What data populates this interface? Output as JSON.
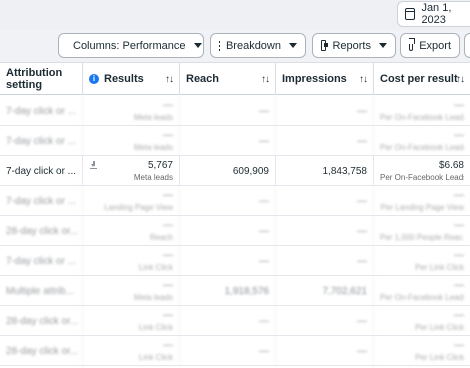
{
  "date_button": {
    "label": "Jan 1, 2023",
    "icon": "calendar-icon"
  },
  "toolbar": {
    "columns_label": "Columns: Performance",
    "breakdown_label": "Breakdown",
    "reports_label": "Reports",
    "export_label": "Export"
  },
  "table": {
    "headers": {
      "attribution": "Attribution setting",
      "results": "Results",
      "reach": "Reach",
      "impressions": "Impressions",
      "cost": "Cost per result",
      "sort_glyph": "↑↓"
    },
    "rows": [
      {
        "name": "7-day click or ...",
        "results": "—",
        "results_sub": "Meta leads",
        "reach": "—",
        "impressions": "—",
        "cost": "—",
        "cost_sub": "Per On-Facebook Leads",
        "blurred": true
      },
      {
        "name": "7-day click or ...",
        "results": "—",
        "results_sub": "Meta leads",
        "reach": "—",
        "impressions": "—",
        "cost": "—",
        "cost_sub": "Per On-Facebook Leads",
        "blurred": true
      },
      {
        "name": "7-day click or ...",
        "results": "5,767",
        "results_sub": "Meta leads",
        "reach": "609,909",
        "impressions": "1,843,758",
        "cost": "$6.68",
        "cost_sub": "Per On-Facebook Leads",
        "blurred": false
      },
      {
        "name": "7-day click or ...",
        "results": "—",
        "results_sub": "Landing Page View",
        "reach": "—",
        "impressions": "—",
        "cost": "—",
        "cost_sub": "Per Landing Page View",
        "blurred": true
      },
      {
        "name": "28-day click or...",
        "results": "—",
        "results_sub": "Reach",
        "reach": "—",
        "impressions": "—",
        "cost": "—",
        "cost_sub": "Per 1,000 People Reac...",
        "blurred": true
      },
      {
        "name": "7-day click or ...",
        "results": "—",
        "results_sub": "Link Click",
        "reach": "—",
        "impressions": "—",
        "cost": "—",
        "cost_sub": "Per Link Click",
        "blurred": true
      },
      {
        "name": "Multiple attrib...",
        "results": "—",
        "results_sub": "Meta leads",
        "reach": "1,918,576",
        "impressions": "7,702,621",
        "cost": "—",
        "cost_sub": "Per On-Facebook Leads",
        "blurred": true
      },
      {
        "name": "28-day click or...",
        "results": "—",
        "results_sub": "Link Click",
        "reach": "—",
        "impressions": "—",
        "cost": "—",
        "cost_sub": "Per Link Click",
        "blurred": true
      },
      {
        "name": "28-day click or...",
        "results": "—",
        "results_sub": "Link Click",
        "reach": "—",
        "impressions": "—",
        "cost": "—",
        "cost_sub": "Per Link Click",
        "blurred": true
      }
    ]
  }
}
